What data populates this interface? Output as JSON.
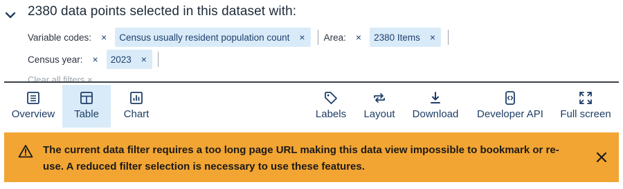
{
  "header": {
    "title": "2380 data points selected in this dataset with:"
  },
  "filters": {
    "variable_codes_label": "Variable codes:",
    "variable_codes_chip": "Census usually resident population count",
    "area_label": "Area:",
    "area_chip": "2380 Items",
    "census_year_label": "Census year:",
    "census_year_chip": "2023",
    "remove_symbol": "×",
    "clear_all": "Clear all filters ×"
  },
  "toolbar": {
    "overview": "Overview",
    "table": "Table",
    "chart": "Chart",
    "labels": "Labels",
    "layout": "Layout",
    "download": "Download",
    "developer_api": "Developer API",
    "full_screen": "Full screen"
  },
  "warning": {
    "message": "The current data filter requires a too long page URL making this data view impossible to bookmark or re-use. A reduced filter selection is necessary to use these features."
  },
  "colors": {
    "accent_blue": "#1d3d66",
    "chip_bg": "#d9ebf8",
    "warning_bg": "#f2a532"
  }
}
